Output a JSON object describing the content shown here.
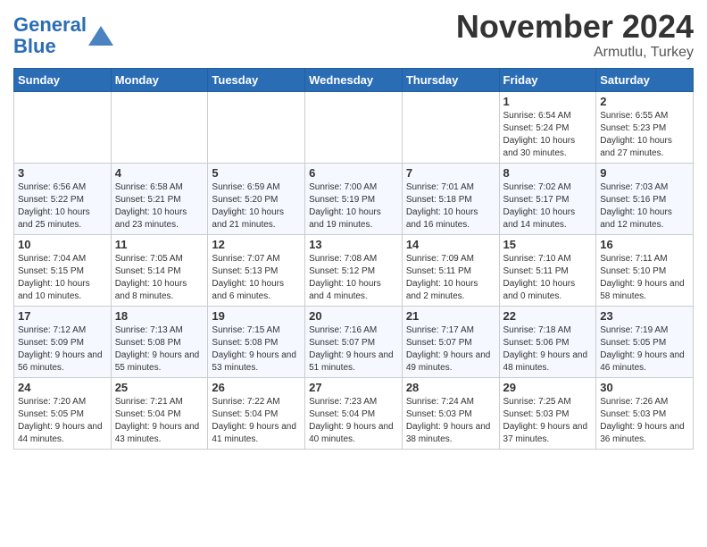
{
  "header": {
    "logo_line1": "General",
    "logo_line2": "Blue",
    "month": "November 2024",
    "location": "Armutlu, Turkey"
  },
  "days_of_week": [
    "Sunday",
    "Monday",
    "Tuesday",
    "Wednesday",
    "Thursday",
    "Friday",
    "Saturday"
  ],
  "weeks": [
    [
      {
        "day": "",
        "info": ""
      },
      {
        "day": "",
        "info": ""
      },
      {
        "day": "",
        "info": ""
      },
      {
        "day": "",
        "info": ""
      },
      {
        "day": "",
        "info": ""
      },
      {
        "day": "1",
        "info": "Sunrise: 6:54 AM\nSunset: 5:24 PM\nDaylight: 10 hours and 30 minutes."
      },
      {
        "day": "2",
        "info": "Sunrise: 6:55 AM\nSunset: 5:23 PM\nDaylight: 10 hours and 27 minutes."
      }
    ],
    [
      {
        "day": "3",
        "info": "Sunrise: 6:56 AM\nSunset: 5:22 PM\nDaylight: 10 hours and 25 minutes."
      },
      {
        "day": "4",
        "info": "Sunrise: 6:58 AM\nSunset: 5:21 PM\nDaylight: 10 hours and 23 minutes."
      },
      {
        "day": "5",
        "info": "Sunrise: 6:59 AM\nSunset: 5:20 PM\nDaylight: 10 hours and 21 minutes."
      },
      {
        "day": "6",
        "info": "Sunrise: 7:00 AM\nSunset: 5:19 PM\nDaylight: 10 hours and 19 minutes."
      },
      {
        "day": "7",
        "info": "Sunrise: 7:01 AM\nSunset: 5:18 PM\nDaylight: 10 hours and 16 minutes."
      },
      {
        "day": "8",
        "info": "Sunrise: 7:02 AM\nSunset: 5:17 PM\nDaylight: 10 hours and 14 minutes."
      },
      {
        "day": "9",
        "info": "Sunrise: 7:03 AM\nSunset: 5:16 PM\nDaylight: 10 hours and 12 minutes."
      }
    ],
    [
      {
        "day": "10",
        "info": "Sunrise: 7:04 AM\nSunset: 5:15 PM\nDaylight: 10 hours and 10 minutes."
      },
      {
        "day": "11",
        "info": "Sunrise: 7:05 AM\nSunset: 5:14 PM\nDaylight: 10 hours and 8 minutes."
      },
      {
        "day": "12",
        "info": "Sunrise: 7:07 AM\nSunset: 5:13 PM\nDaylight: 10 hours and 6 minutes."
      },
      {
        "day": "13",
        "info": "Sunrise: 7:08 AM\nSunset: 5:12 PM\nDaylight: 10 hours and 4 minutes."
      },
      {
        "day": "14",
        "info": "Sunrise: 7:09 AM\nSunset: 5:11 PM\nDaylight: 10 hours and 2 minutes."
      },
      {
        "day": "15",
        "info": "Sunrise: 7:10 AM\nSunset: 5:11 PM\nDaylight: 10 hours and 0 minutes."
      },
      {
        "day": "16",
        "info": "Sunrise: 7:11 AM\nSunset: 5:10 PM\nDaylight: 9 hours and 58 minutes."
      }
    ],
    [
      {
        "day": "17",
        "info": "Sunrise: 7:12 AM\nSunset: 5:09 PM\nDaylight: 9 hours and 56 minutes."
      },
      {
        "day": "18",
        "info": "Sunrise: 7:13 AM\nSunset: 5:08 PM\nDaylight: 9 hours and 55 minutes."
      },
      {
        "day": "19",
        "info": "Sunrise: 7:15 AM\nSunset: 5:08 PM\nDaylight: 9 hours and 53 minutes."
      },
      {
        "day": "20",
        "info": "Sunrise: 7:16 AM\nSunset: 5:07 PM\nDaylight: 9 hours and 51 minutes."
      },
      {
        "day": "21",
        "info": "Sunrise: 7:17 AM\nSunset: 5:07 PM\nDaylight: 9 hours and 49 minutes."
      },
      {
        "day": "22",
        "info": "Sunrise: 7:18 AM\nSunset: 5:06 PM\nDaylight: 9 hours and 48 minutes."
      },
      {
        "day": "23",
        "info": "Sunrise: 7:19 AM\nSunset: 5:05 PM\nDaylight: 9 hours and 46 minutes."
      }
    ],
    [
      {
        "day": "24",
        "info": "Sunrise: 7:20 AM\nSunset: 5:05 PM\nDaylight: 9 hours and 44 minutes."
      },
      {
        "day": "25",
        "info": "Sunrise: 7:21 AM\nSunset: 5:04 PM\nDaylight: 9 hours and 43 minutes."
      },
      {
        "day": "26",
        "info": "Sunrise: 7:22 AM\nSunset: 5:04 PM\nDaylight: 9 hours and 41 minutes."
      },
      {
        "day": "27",
        "info": "Sunrise: 7:23 AM\nSunset: 5:04 PM\nDaylight: 9 hours and 40 minutes."
      },
      {
        "day": "28",
        "info": "Sunrise: 7:24 AM\nSunset: 5:03 PM\nDaylight: 9 hours and 38 minutes."
      },
      {
        "day": "29",
        "info": "Sunrise: 7:25 AM\nSunset: 5:03 PM\nDaylight: 9 hours and 37 minutes."
      },
      {
        "day": "30",
        "info": "Sunrise: 7:26 AM\nSunset: 5:03 PM\nDaylight: 9 hours and 36 minutes."
      }
    ]
  ]
}
